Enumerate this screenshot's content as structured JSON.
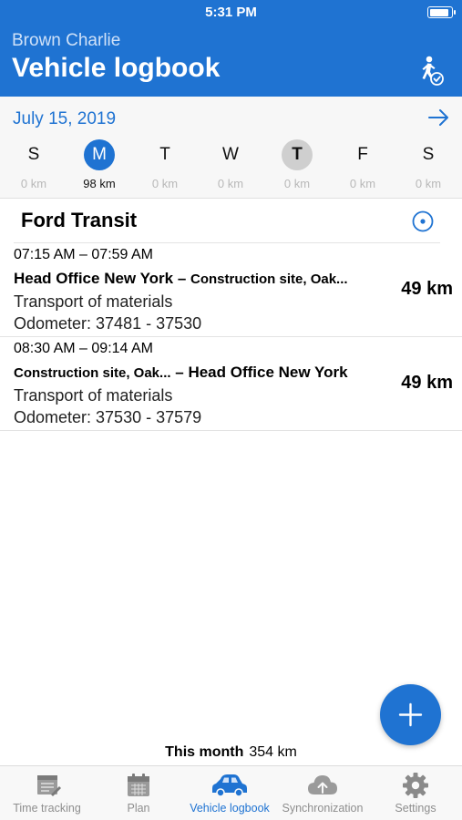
{
  "status_bar": {
    "time": "5:31 PM",
    "battery_level": 0.9
  },
  "header": {
    "user_name": "Brown Charlie",
    "title": "Vehicle logbook",
    "driver_icon": "driver-check-icon"
  },
  "week": {
    "date": "July 15, 2019",
    "days": [
      {
        "letter": "S",
        "km": "0 km",
        "state": "normal"
      },
      {
        "letter": "M",
        "km": "98 km",
        "state": "selected"
      },
      {
        "letter": "T",
        "km": "0 km",
        "state": "normal"
      },
      {
        "letter": "W",
        "km": "0 km",
        "state": "normal"
      },
      {
        "letter": "T",
        "km": "0 km",
        "state": "today"
      },
      {
        "letter": "F",
        "km": "0 km",
        "state": "normal"
      },
      {
        "letter": "S",
        "km": "0 km",
        "state": "normal"
      }
    ]
  },
  "vehicle": {
    "name": "Ford Transit"
  },
  "trips": [
    {
      "start_time": "07:15 AM",
      "end_time": "07:59 AM",
      "from": "Head Office New York",
      "to": "Construction site, Oak...",
      "purpose": "Transport of materials",
      "odometer": "Odometer: 37481 - 37530",
      "distance": "49 km"
    },
    {
      "start_time": "08:30 AM",
      "end_time": "09:14 AM",
      "from": "Construction site, Oak...",
      "to": "Head Office New York",
      "purpose": "Transport of materials",
      "odometer": "Odometer: 37530 - 37579",
      "distance": "49 km"
    }
  ],
  "summary": {
    "label": "This month",
    "value": "354 km"
  },
  "tabs": [
    {
      "label": "Time tracking",
      "icon": "timesheet-icon",
      "active": false
    },
    {
      "label": "Plan",
      "icon": "calendar-icon",
      "active": false
    },
    {
      "label": "Vehicle logbook",
      "icon": "car-icon",
      "active": true
    },
    {
      "label": "Synchronization",
      "icon": "cloud-upload-icon",
      "active": false
    },
    {
      "label": "Settings",
      "icon": "gear-icon",
      "active": false
    }
  ],
  "colors": {
    "accent": "#1f73d2",
    "inactive": "#8e8e8e",
    "today_highlight": "#cfcfcf"
  }
}
